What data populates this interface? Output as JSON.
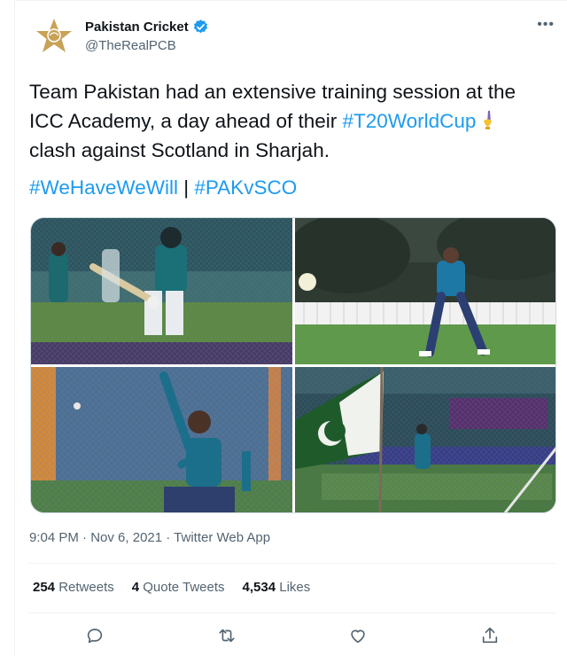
{
  "account": {
    "display_name": "Pakistan Cricket",
    "handle": "@TheRealPCB",
    "verified": true
  },
  "tweet": {
    "line1": "Team Pakistan had an extensive training session at the",
    "line2_prefix": "ICC Academy, a day ahead of their ",
    "line2_hashtag": "#T20WorldCup",
    "line3": "clash against Scotland in Sharjah.",
    "hashtag_1": "#WeHaveWeWill",
    "separator": " | ",
    "hashtag_2": "#PAKvSCO"
  },
  "meta": {
    "time": "9:04 PM",
    "date": "Nov 6, 2021",
    "source": "Twitter Web App",
    "dot": " · "
  },
  "stats": {
    "retweets_count": "254",
    "retweets_label": "Retweets",
    "quotes_count": "4",
    "quotes_label": "Quote Tweets",
    "likes_count": "4,534",
    "likes_label": "Likes"
  },
  "icons": {
    "avatar": "pcb-star-logo",
    "verified": "verified-badge-icon",
    "more": "more-icon",
    "reply": "reply-icon",
    "retweet": "retweet-icon",
    "like": "like-icon",
    "share": "share-icon"
  },
  "colors": {
    "link": "#1d9bf0",
    "text": "#0f1419",
    "secondary": "#536471",
    "logo_gold": "#c8a255"
  }
}
